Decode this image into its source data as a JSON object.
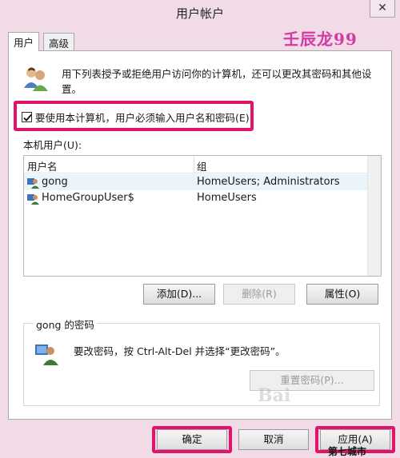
{
  "window": {
    "title": "用户帐户",
    "close_label": "✕"
  },
  "watermark": {
    "top_text": "壬辰龙99",
    "bottom_text": "第七城市",
    "baidu_text": "Bai"
  },
  "tabs": [
    {
      "label": "用户",
      "active": true
    },
    {
      "label": "高级",
      "active": false
    }
  ],
  "description": "用下列表授予或拒绝用户访问你的计算机，还可以更改其密码和其他设置。",
  "require_password": {
    "label": "要使用本计算机，用户必须输入用户名和密码(E)",
    "checked": true
  },
  "local_users": {
    "label": "本机用户(U):",
    "columns": [
      "用户名",
      "组"
    ],
    "rows": [
      {
        "name": "gong",
        "group": "HomeUsers; Administrators"
      },
      {
        "name": "HomeGroupUser$",
        "group": "HomeUsers"
      }
    ]
  },
  "list_buttons": {
    "add": "添加(D)...",
    "remove": "删除(R)",
    "properties": "属性(O)"
  },
  "password_section": {
    "title": "gong 的密码",
    "text": "要改密码，按 Ctrl-Alt-Del 并选择“更改密码”。",
    "reset_button": "重置密码(P)..."
  },
  "footer": {
    "ok": "确定",
    "cancel": "取消",
    "apply": "应用(A)"
  },
  "colors": {
    "highlight_border": "#e0146a",
    "watermark_pink": "#d43aa6",
    "window_bg": "#f1dbe6"
  }
}
